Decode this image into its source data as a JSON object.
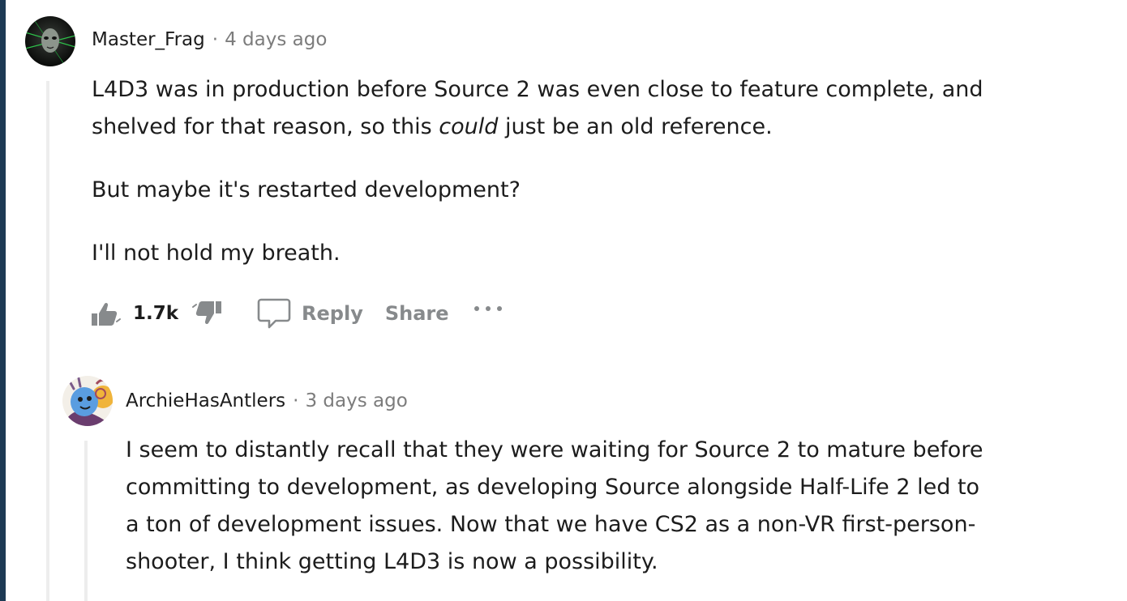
{
  "comments": [
    {
      "author": "Master_Frag",
      "separator": "·",
      "time": "4 days ago",
      "paragraphs": [
        {
          "line1": "L4D3 was in production before Source 2 was even close to feature complete, and",
          "line2_before": "shelved for that reason, so this ",
          "line2_emphasis": "could",
          "line2_after": " just be an old reference."
        },
        {
          "text": "But maybe it's restarted development?"
        },
        {
          "text": "I'll not hold my breath."
        }
      ],
      "votes": "1.7k",
      "actions": {
        "reply": "Reply",
        "share": "Share",
        "more": "···"
      },
      "icons": [
        "upvote-icon",
        "downvote-icon",
        "comment-icon",
        "more-icon"
      ]
    },
    {
      "author": "ArchieHasAntlers",
      "separator": "·",
      "time": "3 days ago",
      "lines": [
        "I seem to distantly recall that they were waiting for Source 2 to mature before",
        "committing to development, as developing Source alongside Half-Life 2 led to",
        "a ton of development issues. Now that we have CS2 as a non-VR first-person-",
        "shooter, I think getting L4D3 is now a possibility."
      ]
    }
  ],
  "colors": {
    "sidebar_edge": "#1d3a54",
    "text": "#1c1c1c",
    "muted": "#7c7c7c",
    "action": "#878a8c",
    "thread_line": "#ededed"
  }
}
